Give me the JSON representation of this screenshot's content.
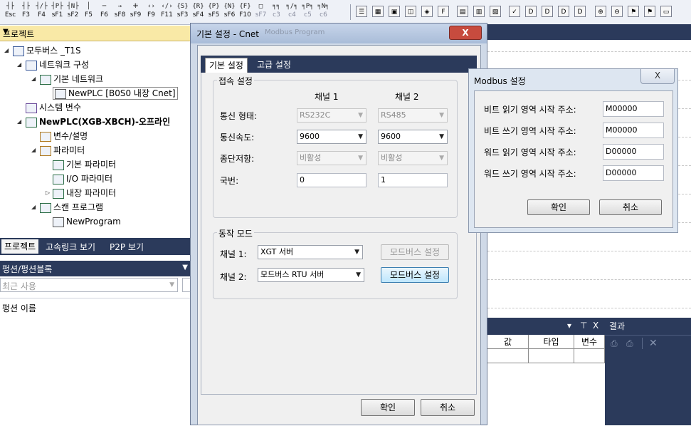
{
  "toolbar": {
    "keys": [
      {
        "sym": "┤├",
        "label": "Esc"
      },
      {
        "sym": "┤├",
        "label": "F3"
      },
      {
        "sym": "┤/├",
        "label": "F4"
      },
      {
        "sym": "┤P├",
        "label": "sF1"
      },
      {
        "sym": "┤N├",
        "label": "sF2"
      },
      {
        "sym": "│",
        "label": "F5"
      },
      {
        "sym": "─",
        "label": "F6"
      },
      {
        "sym": "→",
        "label": "sF8"
      },
      {
        "sym": "⁜",
        "label": "sF9"
      },
      {
        "sym": "‹›",
        "label": "F9"
      },
      {
        "sym": "‹/›",
        "label": "F11"
      },
      {
        "sym": "{S}",
        "label": "sF3"
      },
      {
        "sym": "{R}",
        "label": "sF4"
      },
      {
        "sym": "{P}",
        "label": "sF5"
      },
      {
        "sym": "{N}",
        "label": "sF6"
      },
      {
        "sym": "{F}",
        "label": "F10"
      },
      {
        "sym": "□",
        "label": "sF7"
      },
      {
        "sym": "╕╕",
        "label": "c3"
      },
      {
        "sym": "╕/╕",
        "label": "c4"
      },
      {
        "sym": "╕P╕",
        "label": "c5"
      },
      {
        "sym": "╕N╕",
        "label": "c6"
      }
    ],
    "icons": [
      "list",
      "grid",
      "image",
      "image2",
      "image3",
      "F",
      "calc",
      "table",
      "table2",
      "check",
      "D",
      "D2",
      "D3",
      "D4",
      "zoom-in",
      "zoom-out",
      "run",
      "stop",
      "window"
    ]
  },
  "project_pane": {
    "title": "프로젝트",
    "tree": [
      {
        "label": "모두버스 _T1S",
        "icon": "project-icon"
      },
      {
        "label": "네트워크 구성",
        "icon": "network-icon"
      },
      {
        "label": "기본 네트워크",
        "icon": "basic-network-icon"
      },
      {
        "label": "NewPLC [B0S0 내장 Cnet]",
        "icon": "plc-icon"
      },
      {
        "label": "시스템 변수",
        "icon": "system-var-icon"
      },
      {
        "label": "NewPLC(XGB-XBCH)-오프라인",
        "icon": "plc-offline-icon"
      },
      {
        "label": "변수/설명",
        "icon": "variable-icon"
      },
      {
        "label": "파라미터",
        "icon": "parameter-icon"
      },
      {
        "label": "기본 파라미터",
        "icon": "basic-param-icon"
      },
      {
        "label": "I/O 파라미터",
        "icon": "io-param-icon"
      },
      {
        "label": "내장 파라미터",
        "icon": "builtin-param-icon"
      },
      {
        "label": "스캔 프로그램",
        "icon": "scan-program-icon"
      },
      {
        "label": "NewProgram",
        "icon": "program-icon"
      }
    ],
    "tabs": [
      "프로젝트",
      "고속링크 보기",
      "P2P 보기"
    ]
  },
  "function_pane": {
    "title": "펑션/펑션블록",
    "recent": "최근 사용",
    "list_header": "펑션 이름"
  },
  "dialog": {
    "title": "기본 설정 - Cnet",
    "ghost_title": "Modbus Program",
    "close": "X",
    "tabs": [
      "기본 설정",
      "고급 설정"
    ],
    "connection": {
      "group": "접속 설정",
      "ch1": "채널 1",
      "ch2": "채널 2",
      "rows": [
        {
          "label": "통신 형태:",
          "ch1": "RS232C",
          "ch2": "RS485",
          "enabled": false
        },
        {
          "label": "통신속도:",
          "ch1": "9600",
          "ch2": "9600",
          "enabled": true
        },
        {
          "label": "종단저항:",
          "ch1": "비활성",
          "ch2": "비활성",
          "enabled": false
        },
        {
          "label": "국번:",
          "ch1": "0",
          "ch2": "1",
          "enabled": true
        }
      ]
    },
    "mode": {
      "group": "동작 모드",
      "ch1_label": "채널 1:",
      "ch1_value": "XGT 서버",
      "ch1_button": "모드버스 설정",
      "ch2_label": "채널 2:",
      "ch2_value": "모드버스 RTU 서버",
      "ch2_button": "모드버스 설정"
    },
    "ok": "확인",
    "cancel": "취소"
  },
  "modbus_dialog": {
    "title": "Modbus 설정",
    "close": "X",
    "rows": [
      {
        "label": "비트 읽기 영역 시작 주소:",
        "value": "M00000"
      },
      {
        "label": "비트 쓰기 영역 시작 주소:",
        "value": "M00000"
      },
      {
        "label": "워드 읽기 영역 시작 주소:",
        "value": "D00000"
      },
      {
        "label": "워드 쓰기 영역 시작 주소:",
        "value": "D00000"
      }
    ],
    "ok": "확인",
    "cancel": "취소"
  },
  "variable_panel": {
    "controls": [
      "▾",
      "⊤",
      "X"
    ],
    "columns": [
      "값",
      "타입",
      "변수"
    ]
  },
  "result_panel": {
    "title": "결과"
  }
}
